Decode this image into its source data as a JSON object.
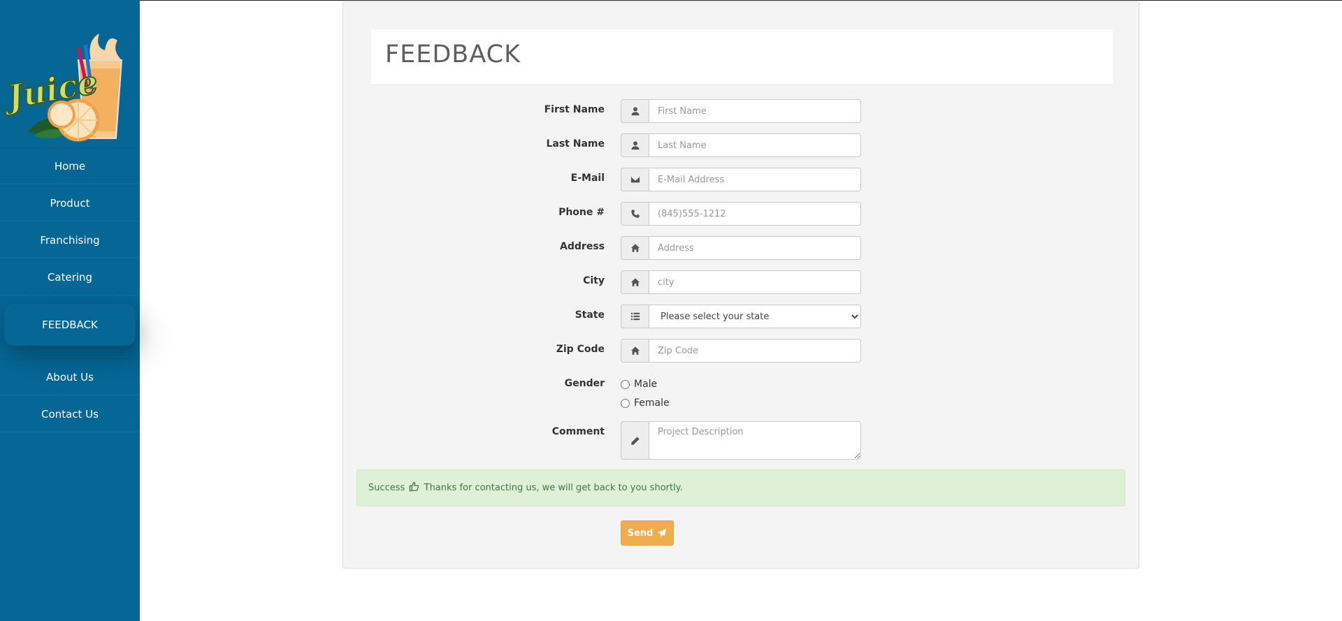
{
  "sidebar": {
    "logo_text": "Juice",
    "items": [
      {
        "label": "Home"
      },
      {
        "label": "Product"
      },
      {
        "label": "Franchising"
      },
      {
        "label": "Catering"
      },
      {
        "label": "FEEDBACK",
        "active": true
      },
      {
        "label": "About Us"
      },
      {
        "label": "Contact Us"
      }
    ]
  },
  "form": {
    "title": "FEEDBACK",
    "fields": {
      "first_name": {
        "label": "First Name",
        "placeholder": "First Name",
        "icon": "user-icon"
      },
      "last_name": {
        "label": "Last Name",
        "placeholder": "Last Name",
        "icon": "user-icon"
      },
      "email": {
        "label": "E-Mail",
        "placeholder": "E-Mail Address",
        "icon": "envelope-icon"
      },
      "phone": {
        "label": "Phone #",
        "placeholder": "(845)555-1212",
        "icon": "phone-icon"
      },
      "address": {
        "label": "Address",
        "placeholder": "Address",
        "icon": "home-icon"
      },
      "city": {
        "label": "City",
        "placeholder": "city",
        "icon": "home-icon"
      },
      "state": {
        "label": "State",
        "selected": "Please select your state",
        "icon": "list-icon"
      },
      "zip": {
        "label": "Zip Code",
        "placeholder": "Zip Code",
        "icon": "home-icon"
      },
      "gender": {
        "label": "Gender",
        "options": [
          "Male",
          "Female"
        ]
      },
      "comment": {
        "label": "Comment",
        "placeholder": "Project Description",
        "icon": "pencil-icon"
      }
    },
    "alert": {
      "strong": "Success",
      "message": "Thanks for contacting us, we will get back to you shortly.",
      "icon": "thumbs-up-icon"
    },
    "send_label": "Send",
    "send_icon": "paper-plane-icon"
  },
  "colors": {
    "sidebar_bg": "#066696",
    "send_button": "#f0ad4e",
    "alert_bg": "#dff0d8",
    "alert_text": "#3c763d"
  }
}
